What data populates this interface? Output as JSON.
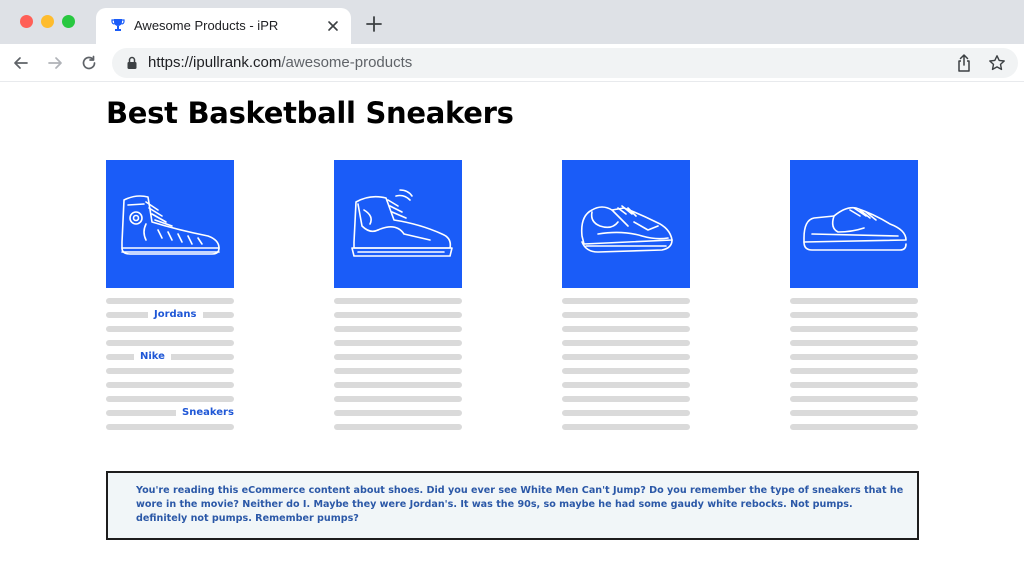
{
  "browser": {
    "tab_title": "Awesome Products - iPR",
    "url_host": "https://ipullrank.com",
    "url_path": "/awesome-products",
    "icons": [
      "back-arrow-icon",
      "forward-arrow-icon",
      "reload-icon",
      "lock-icon",
      "share-icon",
      "star-icon",
      "close-icon",
      "plus-icon",
      "trophy-icon"
    ]
  },
  "page": {
    "title": "Best Basketball Sneakers",
    "accent_color": "#1a5cf8",
    "products": [
      {
        "icon": "high-top-canvas-sneaker-icon"
      },
      {
        "icon": "basketball-high-top-sneaker-icon"
      },
      {
        "icon": "running-sneaker-icon"
      },
      {
        "icon": "low-top-sneaker-icon"
      }
    ],
    "keywords": {
      "jordans": "Jordans",
      "nike": "Nike",
      "sneakers": "Sneakers"
    },
    "note": "You're reading this eCommerce content about shoes. Did you ever see White Men Can't Jump? Do you remember the type of sneakers that he wore in the movie? Neither do I. Maybe they were Jordan's. It was the 90s, so maybe he had some gaudy white rebocks. Not pumps. definitely not pumps. Remember pumps?"
  }
}
